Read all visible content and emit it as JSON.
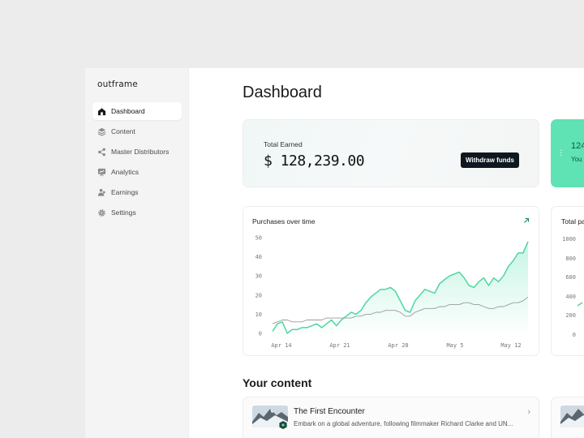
{
  "app": {
    "logo": "outframe"
  },
  "sidebar": {
    "items": [
      {
        "label": "Dashboard",
        "icon": "home-icon",
        "active": true
      },
      {
        "label": "Content",
        "icon": "layers-icon"
      },
      {
        "label": "Master Distributors",
        "icon": "share-icon"
      },
      {
        "label": "Analytics",
        "icon": "analytics-icon"
      },
      {
        "label": "Earnings",
        "icon": "earnings-icon"
      },
      {
        "label": "Settings",
        "icon": "gear-icon"
      }
    ]
  },
  "main": {
    "title": "Dashboard",
    "earned": {
      "label": "Total Earned",
      "value": "$ 128,239.00",
      "button": "Withdraw funds"
    },
    "green_card": {
      "value": "124",
      "sub": "You"
    },
    "purchases_chart_title": "Purchases over time",
    "second_chart_title": "Total pa",
    "section_title": "Your content",
    "content": [
      {
        "title": "The First Encounter",
        "description": "Embark on a global adventure, following filmmaker Richard Clarke and UN..."
      }
    ]
  },
  "colors": {
    "accent": "#5fe2b4",
    "line_primary": "#4fd69f",
    "line_secondary": "#9a9a9a",
    "button_bg": "#0f1720"
  },
  "chart_data": [
    {
      "type": "line",
      "title": "Purchases over time",
      "x_labels": [
        "Apr 14",
        "Apr 21",
        "Apr 28",
        "May 5",
        "May 12"
      ],
      "ylim": [
        0,
        50
      ],
      "y_ticks": [
        "0",
        "10",
        "20",
        "30",
        "40",
        "50"
      ],
      "grid": false,
      "series": [
        {
          "name": "",
          "values": [
            1,
            5,
            6,
            0,
            2,
            2,
            3,
            3,
            4,
            5,
            3,
            5,
            7,
            4,
            7,
            9,
            11,
            10,
            12,
            16,
            19,
            21,
            23,
            23,
            24,
            22,
            17,
            12,
            11,
            17,
            20,
            23,
            22,
            21,
            26,
            28,
            30,
            31,
            32,
            29,
            25,
            24,
            27,
            29,
            25,
            29,
            27,
            30,
            35,
            38,
            42,
            42,
            48
          ]
        },
        {
          "name": "",
          "values": [
            5,
            6,
            7,
            7,
            6,
            6,
            6,
            7,
            7,
            7,
            7,
            8,
            8,
            8,
            8,
            8,
            8,
            9,
            9,
            10,
            10,
            11,
            11,
            12,
            12,
            12,
            11,
            9,
            9,
            11,
            12,
            13,
            13,
            13,
            14,
            14,
            15,
            15,
            15,
            16,
            16,
            15,
            15,
            14,
            13,
            13,
            14,
            14,
            15,
            16,
            16,
            17,
            19
          ]
        }
      ]
    },
    {
      "type": "line",
      "title": "Total pa",
      "y_ticks": [
        "1000",
        "800",
        "600",
        "400",
        "200",
        "0"
      ]
    }
  ]
}
